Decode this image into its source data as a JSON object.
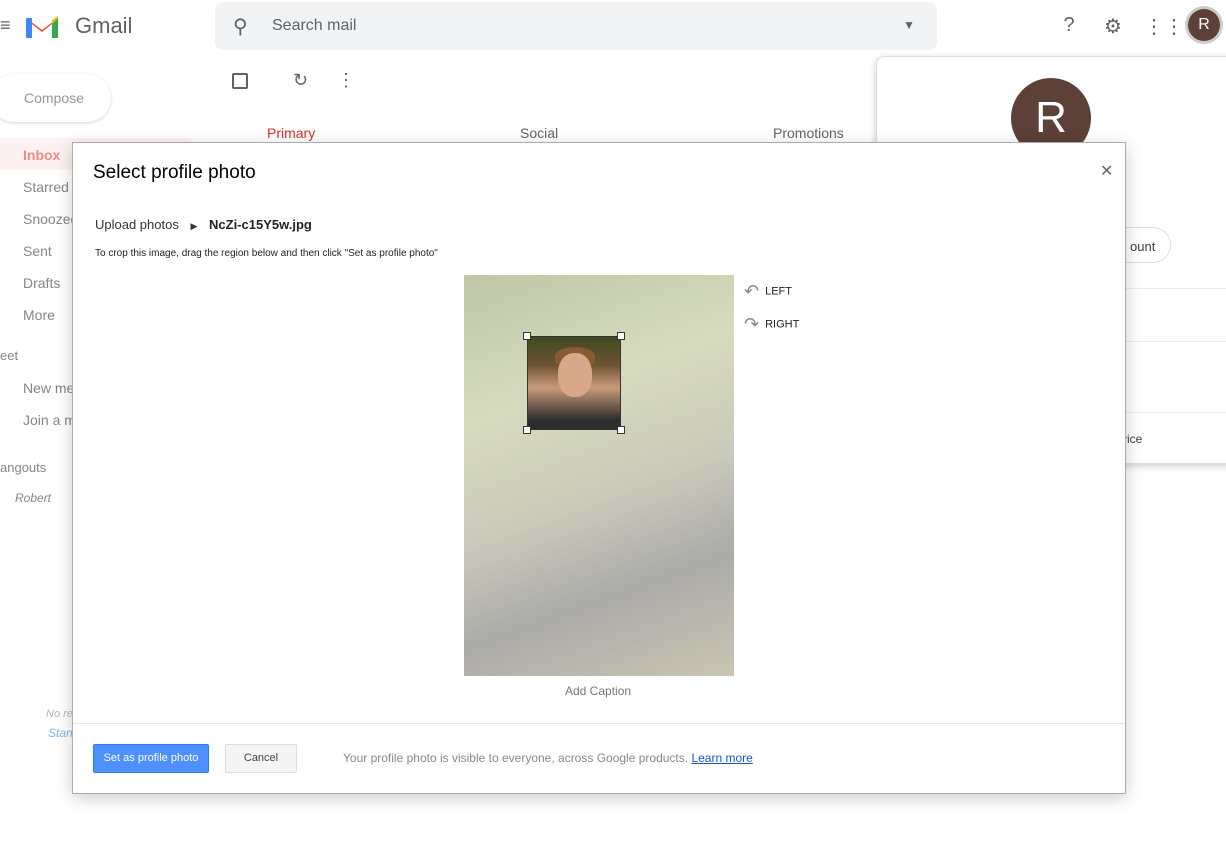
{
  "header": {
    "app_name": "Gmail",
    "search_placeholder": "Search mail",
    "avatar_letter": "R"
  },
  "sidebar": {
    "compose": "Compose",
    "items": [
      {
        "label": "Inbox"
      },
      {
        "label": "Starred"
      },
      {
        "label": "Snoozed"
      },
      {
        "label": "Sent"
      },
      {
        "label": "Drafts"
      },
      {
        "label": "More"
      }
    ],
    "meet_heading": "eet",
    "meet_items": [
      "New me",
      "Join a m"
    ],
    "hangouts_heading": "angouts",
    "hangouts_user": "Robert",
    "no_recent": "No re",
    "start": "Stan"
  },
  "tabs": [
    {
      "label": "Primary"
    },
    {
      "label": "Social"
    },
    {
      "label": "Promotions"
    }
  ],
  "account_panel": {
    "avatar_letter": "R",
    "manage_fragment": "ount",
    "device_fragment": "vice"
  },
  "dialog": {
    "title": "Select profile photo",
    "breadcrumb_root": "Upload photos",
    "filename": "NcZi-c15Y5w.jpg",
    "instructions": "To crop this image, drag the region below and then click \"Set as profile photo\"",
    "rotate_left": "LEFT",
    "rotate_right": "RIGHT",
    "caption": "Add Caption",
    "set_button": "Set as profile photo",
    "cancel_button": "Cancel",
    "note": "Your profile photo is visible to everyone, across Google products.",
    "learn_more": "Learn more"
  },
  "colors": {
    "accent": "#4d90fe",
    "avatar": "#5d4037",
    "primary_tab": "#d93025"
  }
}
